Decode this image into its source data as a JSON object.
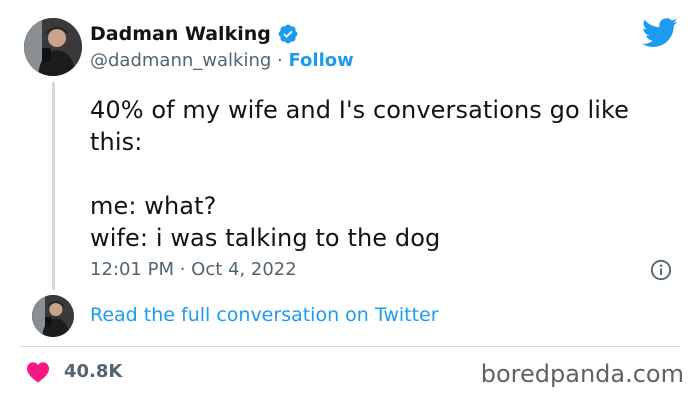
{
  "author": {
    "display_name": "Dadman Walking",
    "handle": "@dadmann_walking",
    "separator": "·",
    "follow_label": "Follow",
    "verified": true
  },
  "tweet": {
    "text": "40% of my wife and I's conversations go like\nthis:\n\nme: what?\nwife: i was talking to the dog",
    "timestamp": "12:01 PM · Oct 4, 2022"
  },
  "thread": {
    "read_more_label": "Read the full conversation on Twitter"
  },
  "engagement": {
    "likes": "40.8K"
  },
  "watermark": {
    "text": "boredpanda.com"
  },
  "colors": {
    "accent": "#1d9bf0",
    "heart": "#f91880",
    "muted": "#536471",
    "text": "#0f1419",
    "divider": "#cfd9de"
  },
  "icons": {
    "verified": "verified-badge-icon",
    "logo": "twitter-bird-icon",
    "info": "info-icon",
    "like": "heart-icon"
  }
}
